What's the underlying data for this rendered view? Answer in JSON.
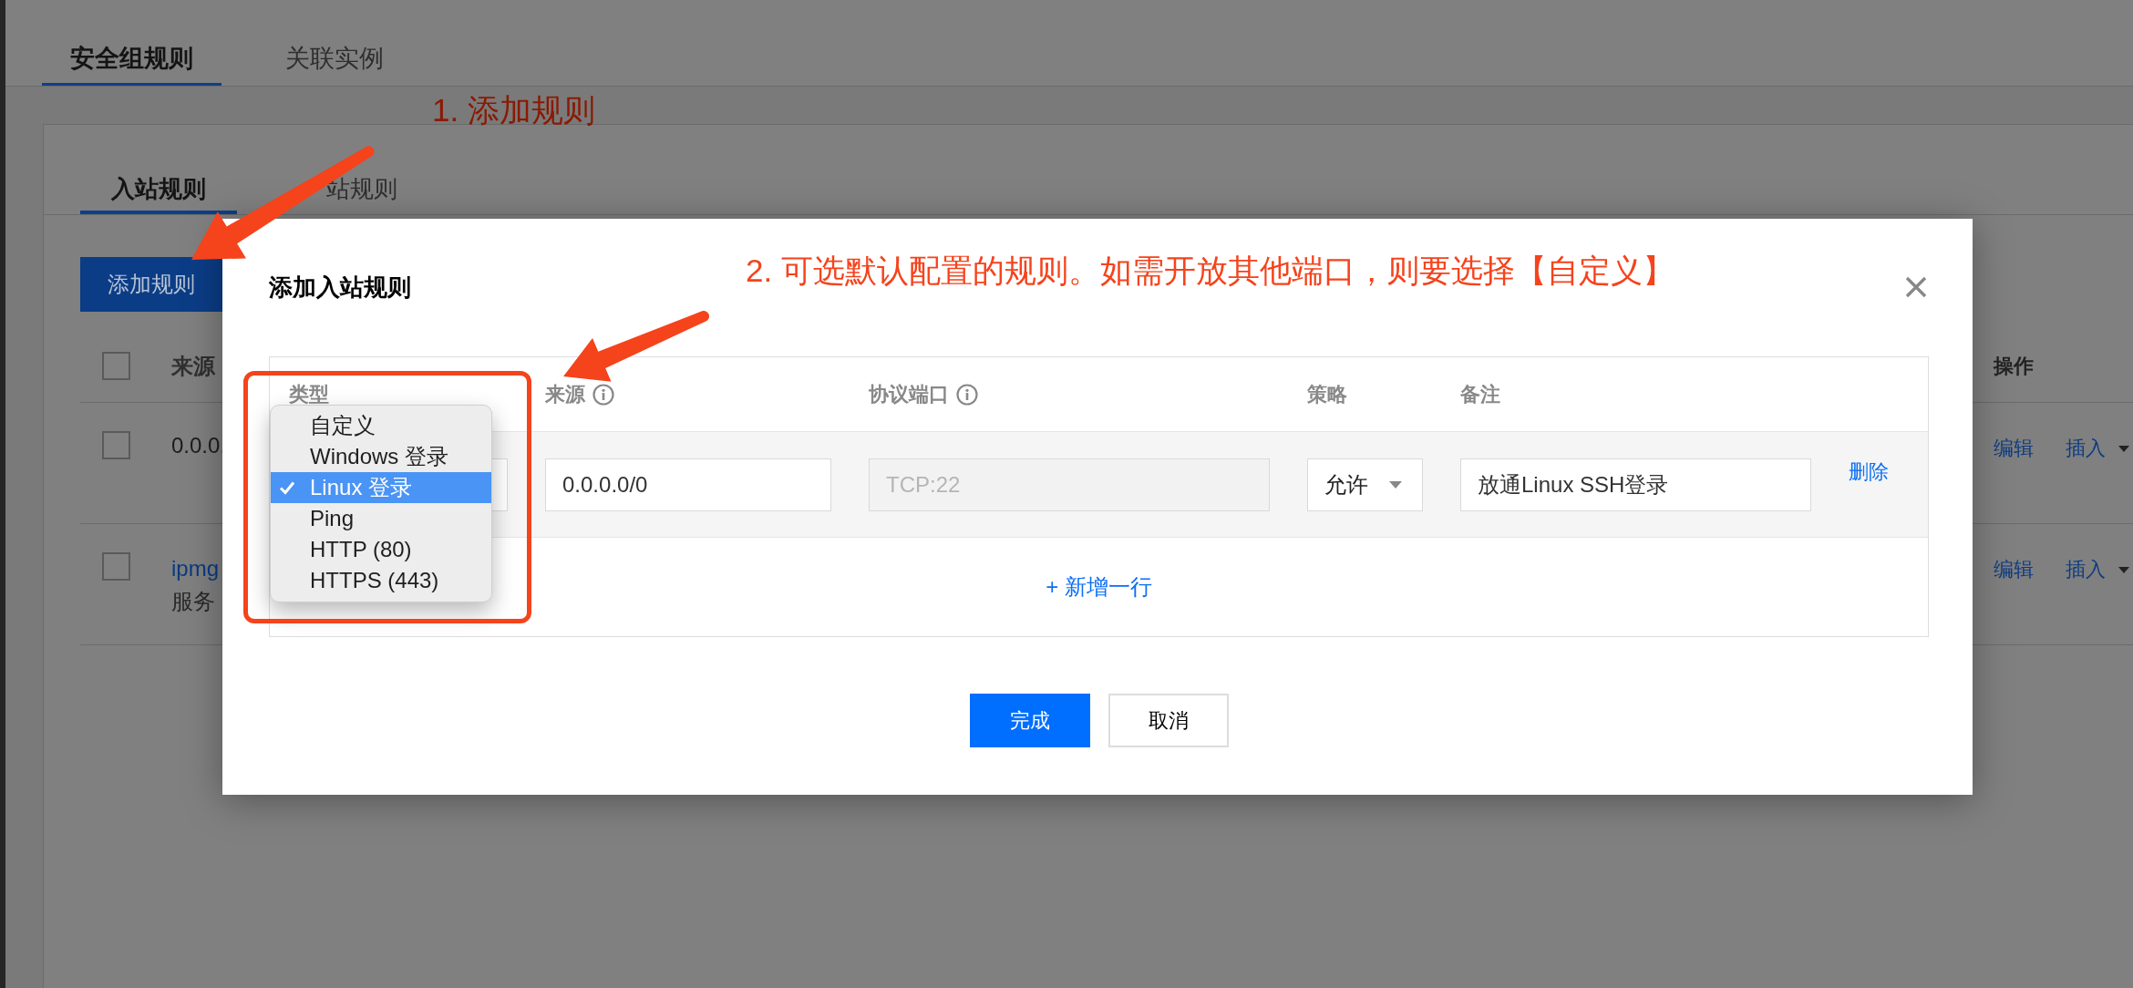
{
  "tabs": [
    {
      "label": "安全组规则",
      "selected": true
    },
    {
      "label": "关联实例",
      "selected": false
    }
  ],
  "rules": {
    "tabs": [
      {
        "label": "入站规则",
        "selected": true
      },
      {
        "label": "站规则",
        "selected": false
      }
    ],
    "add_button": "添加规则",
    "table": {
      "select_all": {
        "checked": false
      },
      "columns": [
        "来源",
        "操作"
      ],
      "rows": [
        {
          "checked": false,
          "source": {
            "kind": "text",
            "text": "0.0.0."
          },
          "actions": [
            {
              "label": "编辑",
              "menu": false
            },
            {
              "label": "插入",
              "menu": true
            }
          ]
        },
        {
          "checked": false,
          "source": {
            "kind": "link",
            "text": "ipmg",
            "detail": "服务"
          },
          "actions": [
            {
              "label": "编辑",
              "menu": false
            },
            {
              "label": "插入",
              "menu": true
            }
          ]
        }
      ]
    }
  },
  "dialog": {
    "title": "添加入站规则",
    "table": {
      "columns": [
        {
          "label": "类型",
          "info": false
        },
        {
          "label": "来源",
          "info": true
        },
        {
          "label": "协议端口",
          "info": true
        },
        {
          "label": "策略",
          "info": false
        },
        {
          "label": "备注",
          "info": false
        }
      ],
      "rows": [
        {
          "source": "0.0.0.0/0",
          "port": {
            "value": "TCP:22",
            "disabled": true
          },
          "policy": "允许",
          "note": "放通Linux SSH登录",
          "delete": "删除"
        }
      ],
      "add_row": "+ 新增一行"
    },
    "type_menu": [
      {
        "label": "自定义",
        "selected": false
      },
      {
        "label": "Windows 登录",
        "selected": false
      },
      {
        "label": "Linux 登录",
        "selected": true
      },
      {
        "label": "Ping",
        "selected": false
      },
      {
        "label": "HTTP (80)",
        "selected": false
      },
      {
        "label": "HTTPS (443)",
        "selected": false
      }
    ],
    "buttons": [
      {
        "label": "完成",
        "kind": "primary"
      },
      {
        "label": "取消",
        "kind": "secondary"
      }
    ]
  },
  "annotations": [
    {
      "text": "1. 添加规则"
    },
    {
      "text": "2. 可选默认配置的规则。如需开放其他端口，则要选择【自定义】"
    }
  ]
}
